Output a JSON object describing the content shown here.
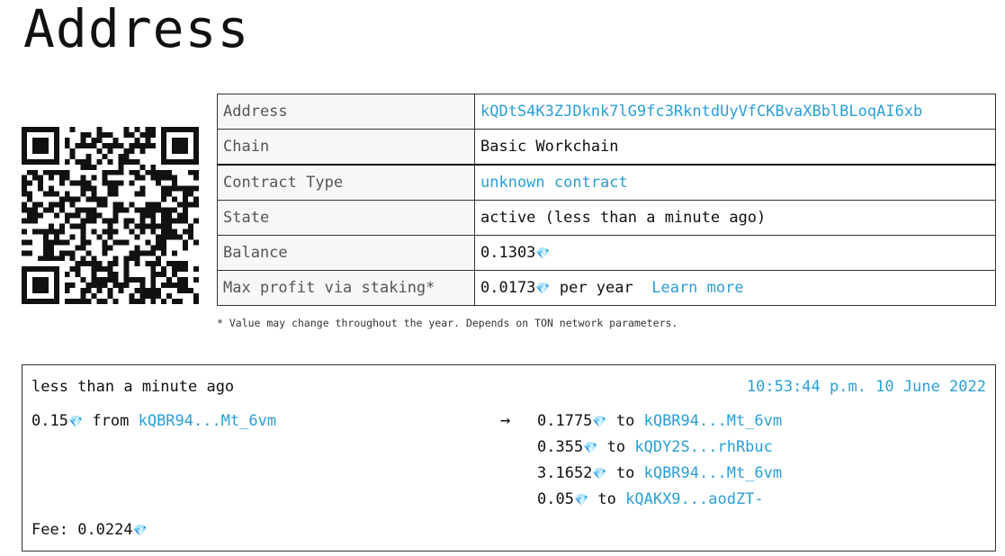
{
  "page": {
    "title": "Address"
  },
  "info": {
    "address_label": "Address",
    "address_value": "kQDtS4K3ZJDknk7lG9fc3RkntdUyVfCKBvaXBblBLoqAI6xb",
    "chain_label": "Chain",
    "chain_value": "Basic Workchain",
    "contract_label": "Contract Type",
    "contract_value": "unknown contract",
    "state_label": "State",
    "state_value": "active (less than a minute ago)",
    "balance_label": "Balance",
    "balance_value": "0.1303",
    "staking_label": "Max profit via staking*",
    "staking_value": "0.0173",
    "staking_suffix": "per year",
    "learn_more": "Learn more"
  },
  "note": "* Value may change throughout the year. Depends on TON network parameters.",
  "transaction": {
    "ago": "less than a minute ago",
    "datetime": "10:53:44 p.m. 10 June 2022",
    "in_amount": "0.15",
    "in_from_label": "from",
    "in_from": "kQBR94...Mt_6vm",
    "arrow": "→",
    "outs": [
      {
        "amount": "0.1775",
        "to_label": "to",
        "to": "kQBR94...Mt_6vm"
      },
      {
        "amount": "0.355",
        "to_label": "to",
        "to": "kQDY2S...rhRbuc"
      },
      {
        "amount": "3.1652",
        "to_label": "to",
        "to": "kQBR94...Mt_6vm"
      },
      {
        "amount": "0.05",
        "to_label": "to",
        "to": "kQAKX9...aodZT-"
      }
    ],
    "fee_label": "Fee:",
    "fee_value": "0.0224"
  },
  "icons": {
    "currency": "diamond-icon",
    "qr": "qr-code"
  },
  "colors": {
    "link": "#2a9fd6",
    "text": "#111111",
    "border": "#333333"
  }
}
